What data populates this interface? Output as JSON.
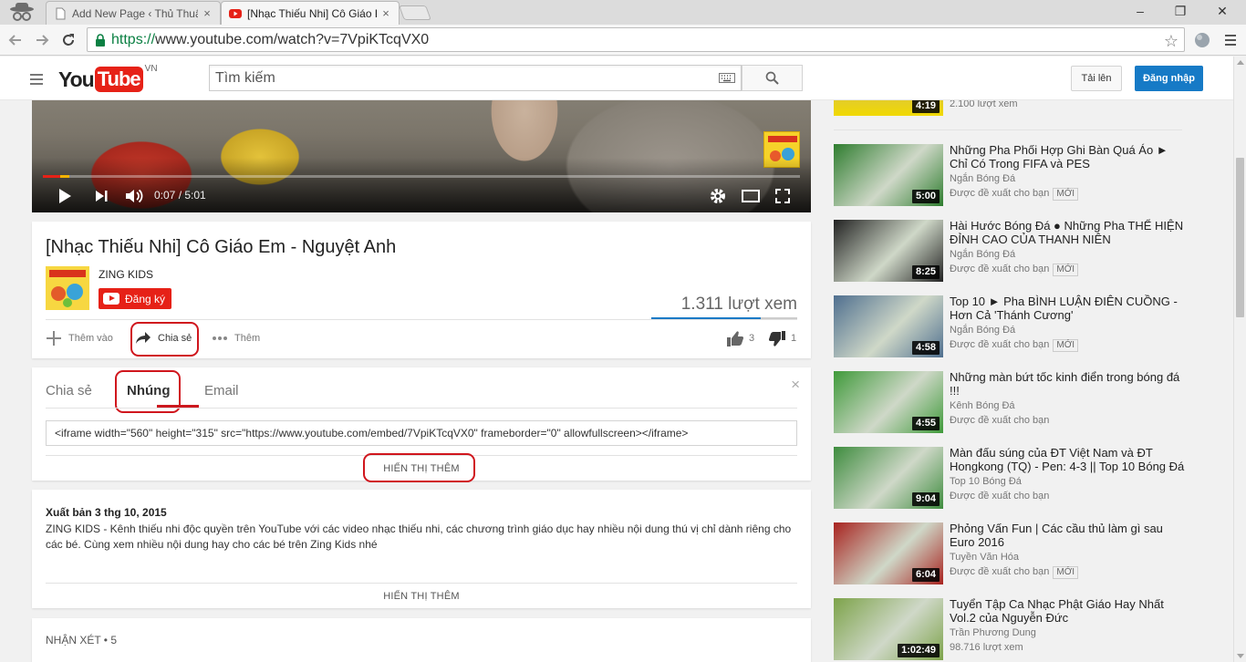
{
  "browser": {
    "tabs": [
      {
        "title": "Add New Page ‹ Thủ Thuật"
      },
      {
        "title": "[Nhạc Thiếu Nhi] Cô Giáo Em"
      }
    ],
    "url_scheme": "https://",
    "url_rest": "www.youtube.com/watch?v=7VpiKTcqVX0",
    "tab_close": "×",
    "win_min": "–",
    "win_restore": "❐",
    "win_close": "✕"
  },
  "masthead": {
    "region": "VN",
    "search_placeholder": "Tìm kiếm",
    "upload_label": "Tải lên",
    "signin_label": "Đăng nhập"
  },
  "player": {
    "time": "0:07 / 5:01",
    "progress": 0.023
  },
  "video": {
    "title": "[Nhạc Thiếu Nhi] Cô Giáo Em - Nguyệt Anh",
    "channel": "ZING KIDS",
    "subscribe_label": "Đăng ký",
    "views": "1.311 lượt xem",
    "like_ratio": 0.75,
    "actions": {
      "add_to": "Thêm vào",
      "share": "Chia sẻ",
      "more": "Thêm"
    },
    "likes": "3",
    "dislikes": "1"
  },
  "share_panel": {
    "tabs": [
      "Chia sẻ",
      "Nhúng",
      "Email"
    ],
    "active_tab": "Nhúng",
    "close": "×",
    "embed_code": "<iframe width=\"560\" height=\"315\" src=\"https://www.youtube.com/embed/7VpiKTcqVX0\" frameborder=\"0\" allowfullscreen></iframe>",
    "show_more": "HIỂN THỊ THÊM"
  },
  "description": {
    "published": "Xuất bản 3 thg 10, 2015",
    "text": "ZING KIDS - Kênh thiếu nhi độc quyền trên YouTube với các video nhạc thiếu nhi, các chương trình giáo dục hay nhiều nội dung thú vị chỉ dành riêng cho các bé. Cùng xem nhiều nội dung hay cho các bé trên Zing Kids nhé",
    "show_more": "HIỂN THỊ THÊM"
  },
  "comments": {
    "header": "NHẬN XÉT • 5"
  },
  "sidebar": {
    "top_partial": {
      "duration": "4:19",
      "meta": "2.100 lượt xem"
    },
    "items": [
      {
        "title": "Những Pha Phối Hợp Ghi Bàn Quá Áo ► Chỉ Có Trong FIFA và PES",
        "channel": "Ngắn Bóng Đá",
        "meta": "Được đề xuất cho bạn",
        "badge": "MỚI",
        "duration": "5:00",
        "color": "#2f7d2f"
      },
      {
        "title": "Hài Hước Bóng Đá ● Những Pha THỂ HIỆN ĐỈNH CAO CỦA THANH NIÊN",
        "channel": "Ngắn Bóng Đá",
        "meta": "Được đề xuất cho bạn",
        "badge": "MỚI",
        "duration": "8:25",
        "color": "#222222"
      },
      {
        "title": "Top 10 ► Pha BÌNH LUẬN ĐIÊN CUỒNG - Hơn Cả 'Thánh Cương'",
        "channel": "Ngắn Bóng Đá",
        "meta": "Được đề xuất cho bạn",
        "badge": "MỚI",
        "duration": "4:58",
        "color": "#4f6f8f"
      },
      {
        "title": "Những màn bứt tốc kinh điển trong bóng đá !!!",
        "channel": "Kênh Bóng Đá",
        "meta": "Được đề xuất cho bạn",
        "badge": "",
        "duration": "4:55",
        "color": "#3f9a3a"
      },
      {
        "title": "Màn đấu súng của ĐT Việt Nam và ĐT Hongkong (TQ) - Pen: 4-3 || Top 10 Bóng Đá",
        "channel": "Top 10 Bóng Đá",
        "meta": "Được đề xuất cho bạn",
        "badge": "",
        "duration": "9:04",
        "color": "#3e8c3e"
      },
      {
        "title": "Phỏng Vấn Fun | Các cầu thủ làm gì sau Euro 2016",
        "channel": "Tuyền Văn Hóa",
        "meta": "Được đề xuất cho bạn",
        "badge": "MỚI",
        "duration": "6:04",
        "color": "#a8231f"
      },
      {
        "title": "Tuyển Tập Ca Nhạc Phật Giáo Hay Nhất Vol.2 của Nguyễn Đức",
        "channel": "Trần Phương Dung",
        "meta": "98.716 lượt xem",
        "badge": "",
        "duration": "1:02:49",
        "color": "#7da34a"
      }
    ]
  }
}
